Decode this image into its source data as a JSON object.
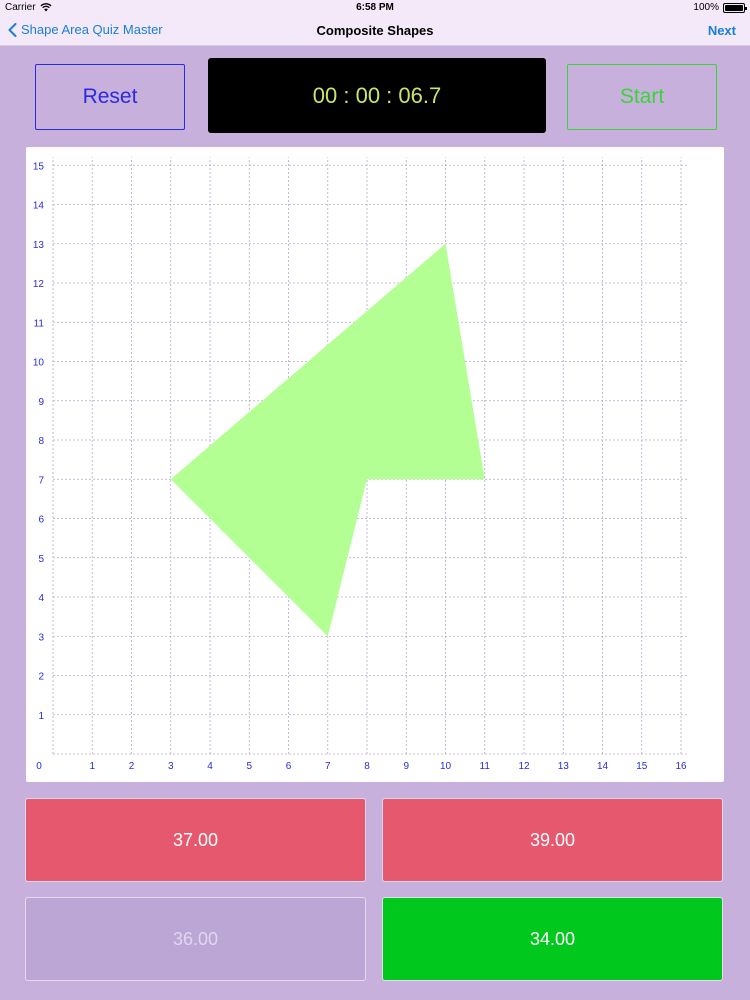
{
  "status": {
    "carrier": "Carrier",
    "time": "6:58 PM",
    "battery": "100%"
  },
  "nav": {
    "back_label": "Shape Area Quiz Master",
    "title": "Composite Shapes",
    "next_label": "Next"
  },
  "controls": {
    "reset_label": "Reset",
    "timer": "00 : 00 : 06.7",
    "start_label": "Start"
  },
  "colors": {
    "background": "#c8b0dc",
    "reset": "#2a2ae0",
    "start": "#3ad43a",
    "timer_text": "#c9e66b",
    "shape_fill": "#b3ff94",
    "wrong_answer": "#e5586e",
    "correct_answer": "#00c81c",
    "disabled_answer": "#bca6d6"
  },
  "graph": {
    "x_ticks": [
      0,
      1,
      2,
      3,
      4,
      5,
      6,
      7,
      8,
      9,
      10,
      11,
      12,
      13,
      14,
      15,
      16
    ],
    "y_ticks": [
      1,
      2,
      3,
      4,
      5,
      6,
      7,
      8,
      9,
      10,
      11,
      12,
      13,
      14,
      15
    ],
    "xlim": [
      0,
      16
    ],
    "ylim": [
      0,
      15
    ],
    "shape_vertices": [
      [
        3,
        7
      ],
      [
        10,
        13
      ],
      [
        11,
        7
      ],
      [
        8,
        7
      ],
      [
        7,
        3
      ]
    ]
  },
  "answers": [
    {
      "label": "37.00",
      "state": "wrong"
    },
    {
      "label": "39.00",
      "state": "wrong"
    },
    {
      "label": "36.00",
      "state": "disabled"
    },
    {
      "label": "34.00",
      "state": "correct"
    }
  ]
}
